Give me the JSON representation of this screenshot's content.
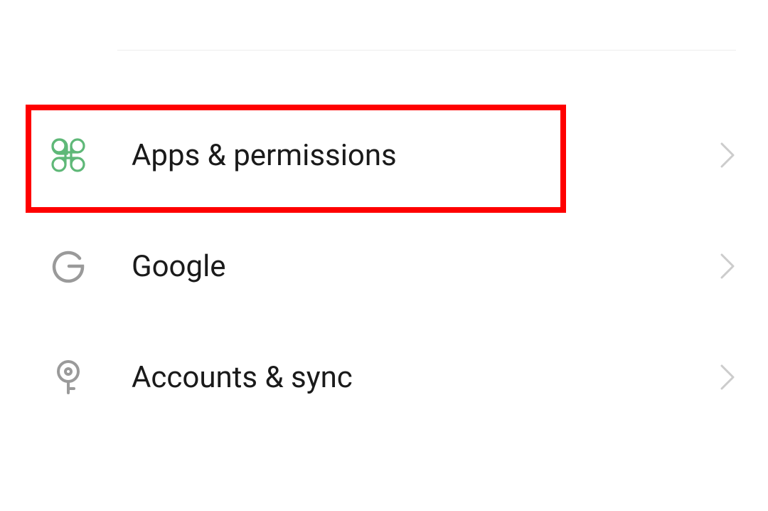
{
  "settings": {
    "items": [
      {
        "id": "apps-permissions",
        "label": "Apps & permissions",
        "icon": "command",
        "iconColor": "#5fb878"
      },
      {
        "id": "google",
        "label": "Google",
        "icon": "google",
        "iconColor": "#9a9a9a"
      },
      {
        "id": "accounts-sync",
        "label": "Accounts & sync",
        "icon": "key",
        "iconColor": "#9a9a9a"
      }
    ]
  },
  "highlight": {
    "target": "apps-permissions"
  }
}
